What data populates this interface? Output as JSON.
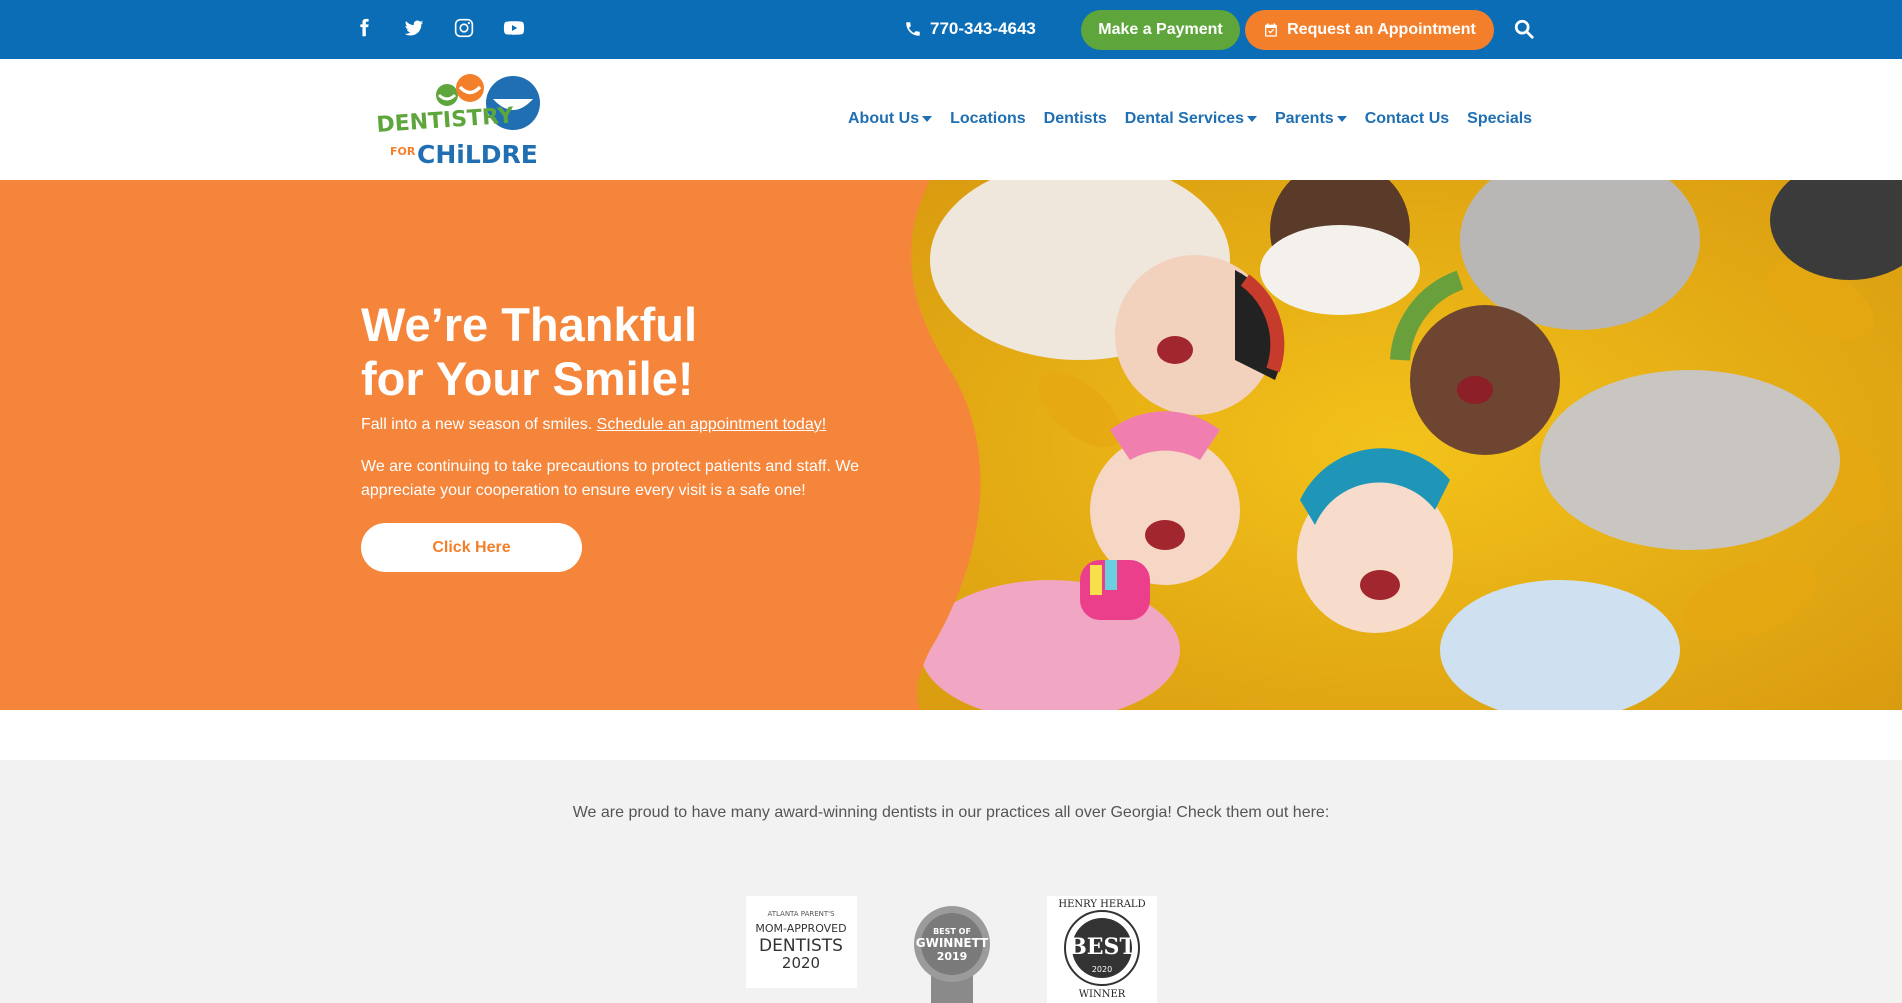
{
  "topbar": {
    "social": [
      {
        "name": "facebook-icon"
      },
      {
        "name": "twitter-icon"
      },
      {
        "name": "instagram-icon"
      },
      {
        "name": "youtube-icon"
      }
    ],
    "phone": "770-343-4643",
    "pay_label": "Make a Payment",
    "appt_label": "Request an Appointment"
  },
  "header": {
    "logo_text_1": "DENTISTRY",
    "logo_text_2": "FOR",
    "logo_text_3": "CHiLDREN",
    "nav": [
      {
        "label": "About Us",
        "dropdown": true
      },
      {
        "label": "Locations",
        "dropdown": false
      },
      {
        "label": "Dentists",
        "dropdown": false
      },
      {
        "label": "Dental Services",
        "dropdown": true
      },
      {
        "label": "Parents",
        "dropdown": true
      },
      {
        "label": "Contact Us",
        "dropdown": false
      },
      {
        "label": "Specials",
        "dropdown": false
      }
    ]
  },
  "hero": {
    "title_line1": "We’re Thankful",
    "title_line2": "for Your Smile!",
    "sub_text": "Fall into a new season of smiles. ",
    "sub_link": "Schedule an appointment today!",
    "body": "We are continuing to take precautions to protect patients and staff. We appreciate your cooperation to ensure every visit is a safe one!",
    "button_label": "Click Here"
  },
  "awards": {
    "text": "We are proud to have many award-winning dentists in our practices all over Georgia! Check them out here:",
    "badge1": {
      "line1": "ATLANTA PARENT'S",
      "line2": "MOM-APPROVED",
      "line3": "DENTISTS",
      "line4": "2020"
    },
    "badge2": {
      "line1": "BEST OF",
      "line2": "GWINNETT",
      "line3": "2019"
    },
    "badge3": {
      "line1": "HENRY HERALD",
      "line2": "BEST",
      "line3": "2020",
      "line4": "WINNER"
    }
  },
  "colors": {
    "topbar": "#0a6db5",
    "brand_blue": "#1f6fb2",
    "orange": "#f47f2a",
    "green": "#5ea63b"
  }
}
